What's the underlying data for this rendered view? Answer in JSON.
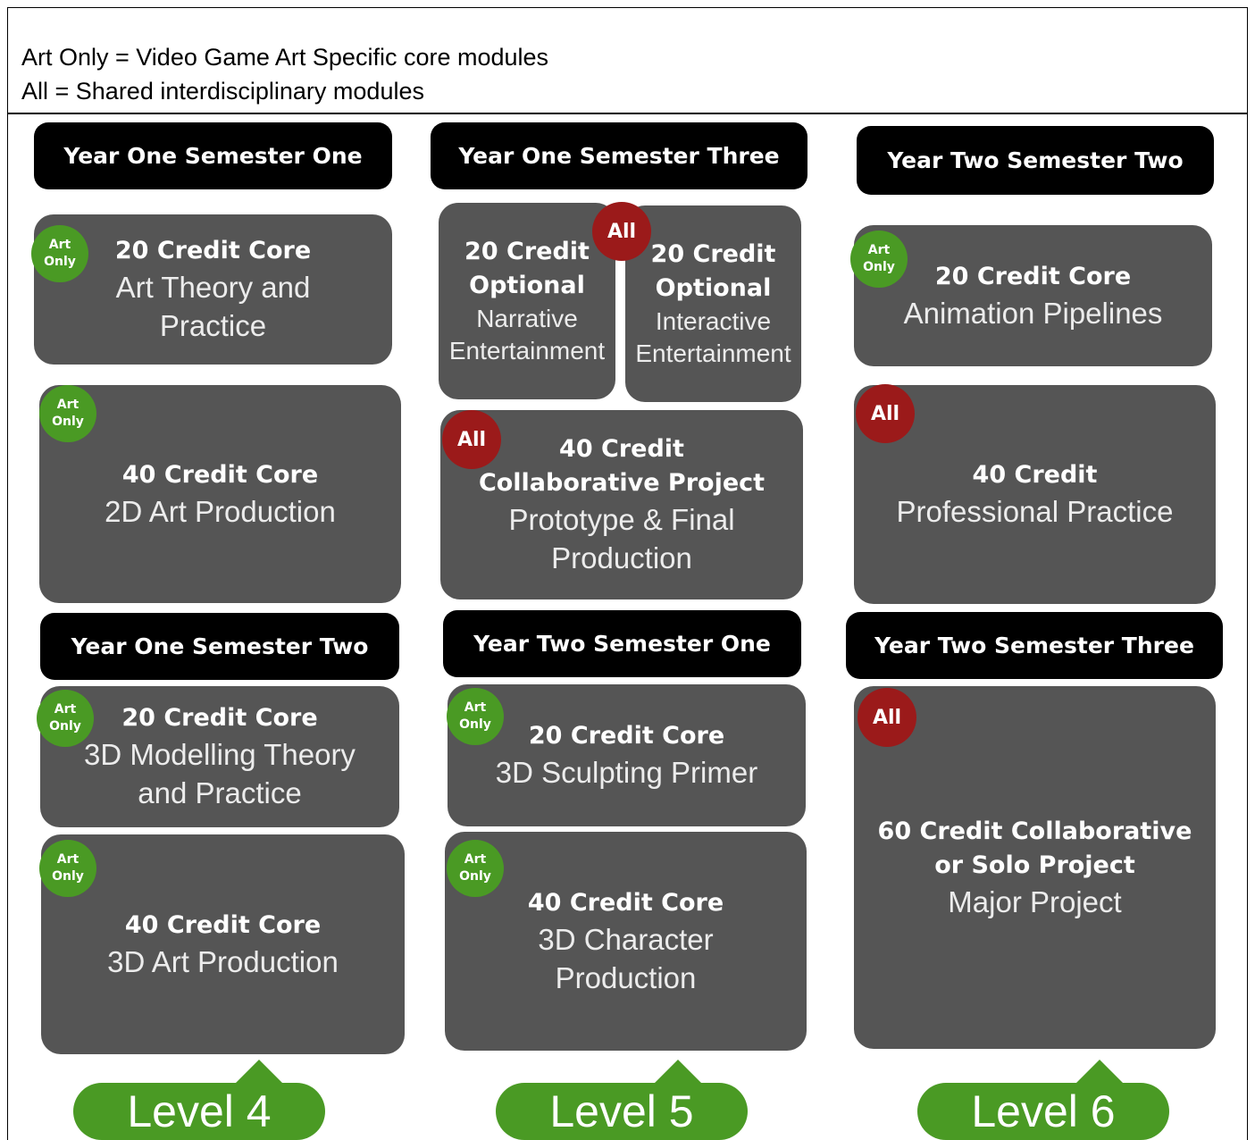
{
  "legend": {
    "art_only": "Art Only = Video Game Art Specific core modules",
    "all": "All = Shared interdisciplinary modules"
  },
  "badges": {
    "art_line1": "Art",
    "art_line2": "Only",
    "all": "All"
  },
  "colors": {
    "header": "#000000",
    "module": "#555555",
    "art_only": "#4a9a24",
    "all": "#9b1a1a",
    "level": "#4a9a24"
  },
  "semesters": {
    "y1s1": "Year One Semester One",
    "y1s2": "Year One Semester Two",
    "y1s3": "Year One Semester Three",
    "y2s1": "Year Two Semester One",
    "y2s2": "Year Two Semester Two",
    "y2s3": "Year Two Semester Three"
  },
  "modules": {
    "art_theory": {
      "l1": "20 Credit Core",
      "l2": "Art Theory and",
      "l3": "Practice"
    },
    "art_2d": {
      "l1": "40 Credit Core",
      "l2": "2D Art Production"
    },
    "modelling_3d": {
      "l1": "20 Credit Core",
      "l2": "3D Modelling Theory",
      "l3": "and Practice"
    },
    "art_3d": {
      "l1": "40 Credit Core",
      "l2": "3D Art Production"
    },
    "narrative": {
      "l1": "20 Credit",
      "l2": "Optional",
      "l3": "Narrative",
      "l4": "Entertainment"
    },
    "interactive": {
      "l1": "20 Credit",
      "l2": "Optional",
      "l3": "Interactive",
      "l4": "Entertainment"
    },
    "collab": {
      "l1": "40 Credit",
      "l2": "Collaborative Project",
      "l3": "Prototype & Final",
      "l4": "Production"
    },
    "sculpting": {
      "l1": "20 Credit Core",
      "l2": "3D Sculpting Primer"
    },
    "character": {
      "l1": "40 Credit Core",
      "l2": "3D Character",
      "l3": "Production"
    },
    "animation": {
      "l1": "20 Credit Core",
      "l2": "Animation Pipelines"
    },
    "professional": {
      "l1": "40 Credit",
      "l2": "Professional Practice"
    },
    "major": {
      "l1": "60 Credit Collaborative",
      "l2": "or Solo Project",
      "l3": "Major Project"
    }
  },
  "levels": {
    "l4": "Level 4",
    "l5": "Level 5",
    "l6": "Level 6"
  }
}
